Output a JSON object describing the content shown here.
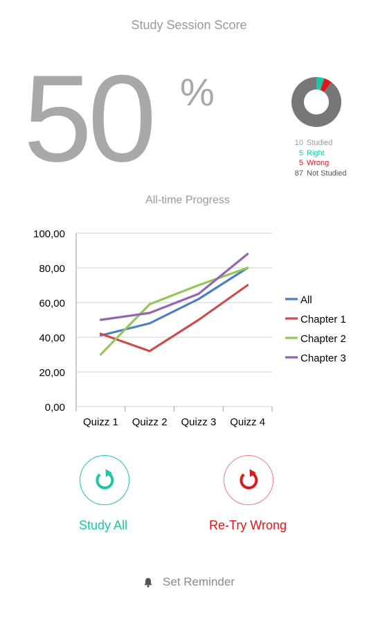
{
  "header": {
    "title": "Study Session Score"
  },
  "score": {
    "value": "50",
    "unit": "%"
  },
  "summary": {
    "donut": {
      "right": 5,
      "wrong": 5,
      "not_studied": 87
    },
    "colors": {
      "right": "#19c8a6",
      "wrong": "#e0161b",
      "not_studied": "#777777"
    },
    "rows": [
      {
        "num": "10",
        "label": "Studied"
      },
      {
        "num": "5",
        "label": "Right"
      },
      {
        "num": "5",
        "label": "Wrong"
      },
      {
        "num": "87",
        "label": "Not Studied"
      }
    ]
  },
  "progress": {
    "title": "All-time Progress"
  },
  "chart_data": {
    "type": "line",
    "categories": [
      "Quizz 1",
      "Quizz 2",
      "Quizz 3",
      "Quizz 4"
    ],
    "ylim": [
      0,
      100
    ],
    "yticks": [
      "0,00",
      "20,00",
      "40,00",
      "60,00",
      "80,00",
      "100,00"
    ],
    "grid": true,
    "legend_position": "right",
    "series": [
      {
        "name": "All",
        "color": "#4a7fc1",
        "values": [
          41,
          48,
          62,
          80
        ]
      },
      {
        "name": "Chapter 1",
        "color": "#cc4b4b",
        "values": [
          42,
          32,
          50,
          70
        ]
      },
      {
        "name": "Chapter 2",
        "color": "#94c75a",
        "values": [
          30,
          59,
          70,
          80
        ]
      },
      {
        "name": "Chapter 3",
        "color": "#9565b4",
        "values": [
          50,
          54,
          65,
          88
        ]
      }
    ]
  },
  "actions": {
    "study_all": "Study All",
    "retry_wrong": "Re-Try Wrong",
    "study_color": "#19c8a6",
    "retry_color": "#e0161b"
  },
  "reminder": {
    "label": "Set Reminder"
  }
}
